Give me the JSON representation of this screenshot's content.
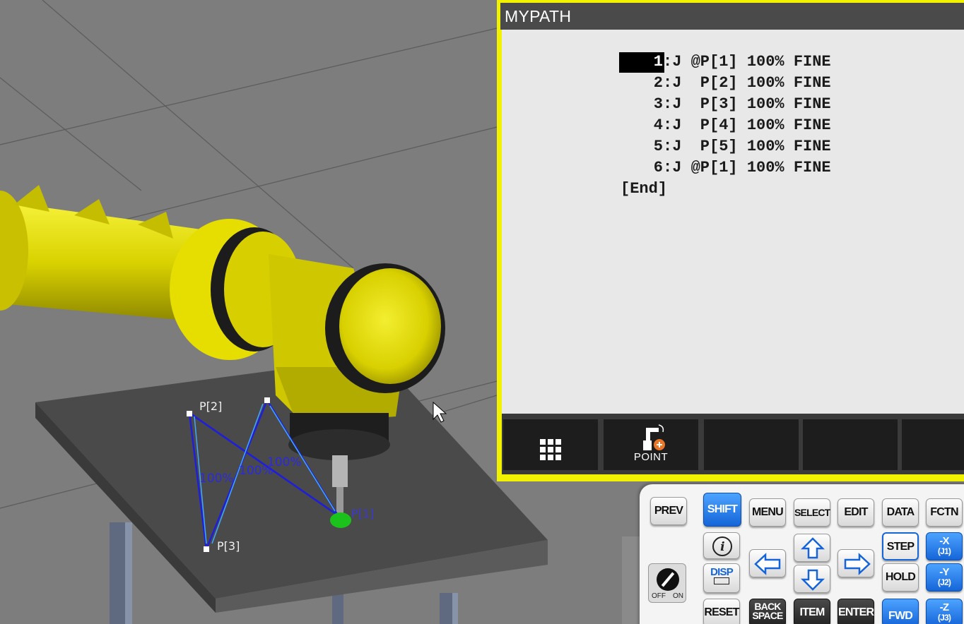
{
  "viewport": {
    "point_labels": [
      "P[2]",
      "P[3]",
      "P[1]"
    ],
    "speed_labels": [
      "100%",
      "100%",
      "100%"
    ],
    "colors": {
      "robot": "#e6e000",
      "table": "#474747",
      "path": "#1a1ad6",
      "target": "#19c219"
    }
  },
  "pendant": {
    "title": "MYPATH",
    "program_lines": [
      {
        "num": "1",
        "text": ":J @P[1] 100% FINE",
        "selected": true
      },
      {
        "num": "2",
        "text": ":J  P[2] 100% FINE"
      },
      {
        "num": "3",
        "text": ":J  P[3] 100% FINE"
      },
      {
        "num": "4",
        "text": ":J  P[4] 100% FINE"
      },
      {
        "num": "5",
        "text": ":J  P[5] 100% FINE"
      },
      {
        "num": "6",
        "text": ":J @P[1] 100% FINE"
      }
    ],
    "end_marker": "[End]",
    "function_keys": {
      "f1_icon": "grid-icon",
      "f2_label": "POINT",
      "f2_icon": "robot-point-icon"
    }
  },
  "keypad": {
    "prev": "PREV",
    "shift": "SHIFT",
    "menu": "MENU",
    "select": "SELECT",
    "edit": "EDIT",
    "data": "DATA",
    "fctn": "FCTN",
    "info_icon": "info-icon",
    "disp": "DISP",
    "step": "STEP",
    "hold": "HOLD",
    "reset": "RESET",
    "backspace_1": "BACK",
    "backspace_2": "SPACE",
    "item": "ITEM",
    "enter": "ENTER",
    "fwd": "FWD",
    "neg_x": "-X",
    "neg_x_sub": "(J1)",
    "neg_y": "-Y",
    "neg_y_sub": "(J2)",
    "neg_z": "-Z",
    "neg_z_sub": "(J3)",
    "switch_off": "OFF",
    "switch_on": "ON"
  }
}
